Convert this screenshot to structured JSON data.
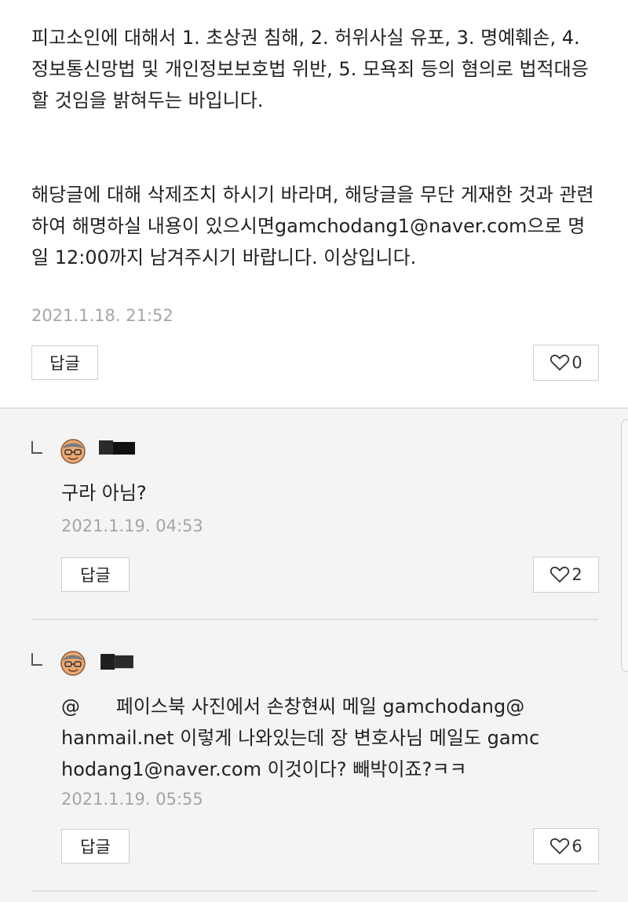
{
  "main_comment": {
    "lines": [
      "피고소인에 대해서 1. 초상권 침해, 2. 허위사실 유포, 3. 명예훼손, 4. 정보통신망법 및 개인정보보호법 위반, 5. 모욕죄 등의 혐의로 법적대응할 것임을 밝혀두는 바입니다.",
      "해당글에 대해 삭제조치 하시기 바라며, 해당글을 무단 게재한 것과 관련하여 해명하실 내용이 있으시면gamchodang1@naver.com으로 명일 12:00까지 남겨주시기 바랍니다. 이상입니다."
    ],
    "timestamp": "2021.1.18. 21:52",
    "reply_label": "답글",
    "like_count": "0"
  },
  "replies": [
    {
      "text": "구라 아님?",
      "timestamp": "2021.1.19. 04:53",
      "reply_label": "답글",
      "like_count": "2"
    },
    {
      "text": "@ 페이스북 사진에서 손창현씨 메일 gamchodang@hanmail.net 이렇게 나와있는데 장 변호사님 메일도 gamchodang1@naver.com 이것이다? 빼박이죠?ㅋㅋ",
      "text_line1": "@      페이스북 사진에서 손창현씨 메일 gamchodang@",
      "text_line2": "hanmail.net 이렇게 나와있는데 장 변호사님 메일도 gamc",
      "text_line3": "hodang1@naver.com 이것이다? 빼박이죠?ㅋㅋ",
      "timestamp": "2021.1.19. 05:55",
      "reply_label": "답글",
      "like_count": "6"
    }
  ],
  "icons": {
    "like": "heart-outline-icon",
    "reply_indicator": "reply-corner-icon",
    "avatar": "default-avatar-icon"
  },
  "colors": {
    "timestamp": "#a5a5a5",
    "reply_background": "#f4f4f4",
    "main_background": "#ffffff"
  }
}
